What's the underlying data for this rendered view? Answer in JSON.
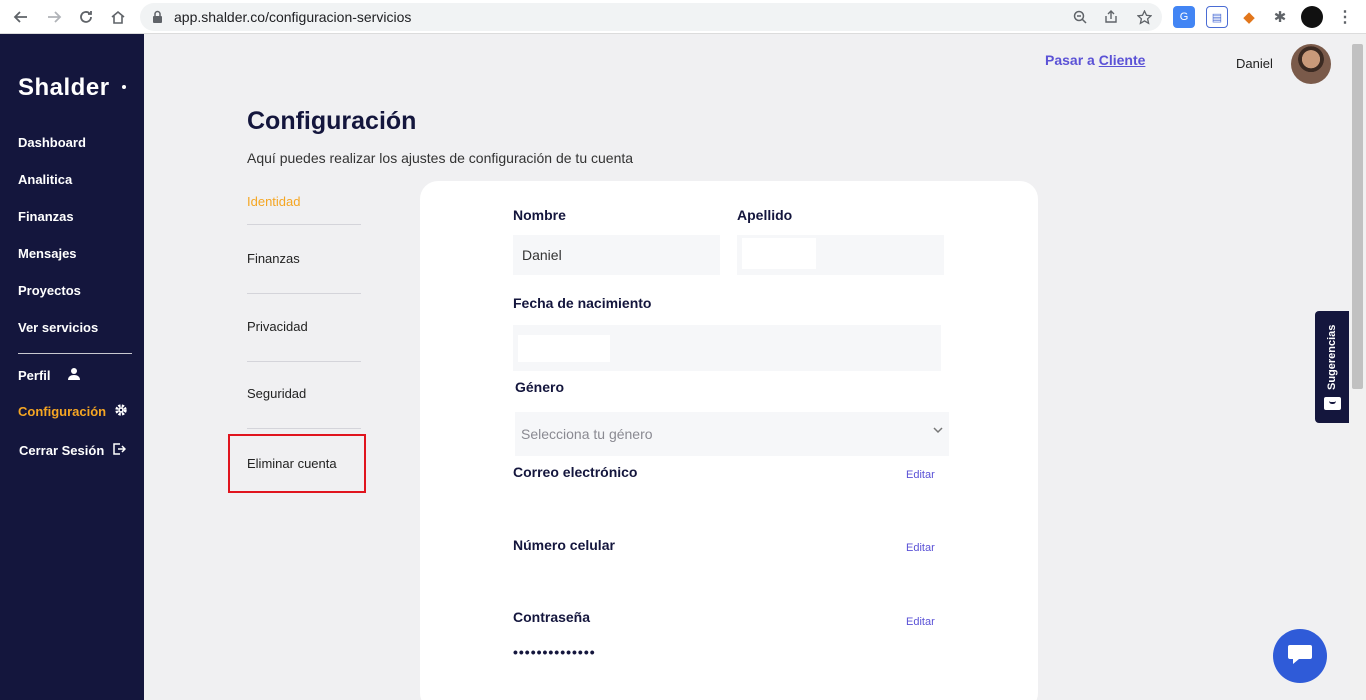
{
  "browser": {
    "url": "app.shalder.co/configuracion-servicios"
  },
  "sidebar": {
    "logo": "Shalder",
    "items": [
      {
        "label": "Dashboard"
      },
      {
        "label": "Analitica"
      },
      {
        "label": "Finanzas"
      },
      {
        "label": "Mensajes"
      },
      {
        "label": "Proyectos"
      },
      {
        "label": "Ver servicios"
      },
      {
        "label": "Perfil"
      },
      {
        "label": "Configuración"
      },
      {
        "label": "Cerrar Sesión"
      }
    ],
    "active_color": "#f5a623",
    "bg_color": "#14163d"
  },
  "header": {
    "switch_prefix": "Pasar a",
    "switch_link": "Cliente",
    "user_name": "Daniel"
  },
  "page": {
    "title": "Configuración",
    "subtitle": "Aquí puedes realizar los ajustes de configuración de tu cuenta"
  },
  "tabs": [
    {
      "label": "Identidad",
      "active": true
    },
    {
      "label": "Finanzas"
    },
    {
      "label": "Privacidad"
    },
    {
      "label": "Seguridad"
    },
    {
      "label": "Eliminar cuenta"
    }
  ],
  "form": {
    "first_name_label": "Nombre",
    "first_name_value": "Daniel",
    "last_name_label": "Apellido",
    "birthdate_label": "Fecha de nacimiento",
    "gender_label": "Género",
    "gender_placeholder": "Selecciona tu género",
    "email_label": "Correo electrónico",
    "phone_label": "Número celular",
    "password_label": "Contraseña",
    "password_value": "••••••••••••••",
    "edit_label": "Editar"
  },
  "feedback_tab": "Sugerencias",
  "accent_color": "#5b52d6"
}
